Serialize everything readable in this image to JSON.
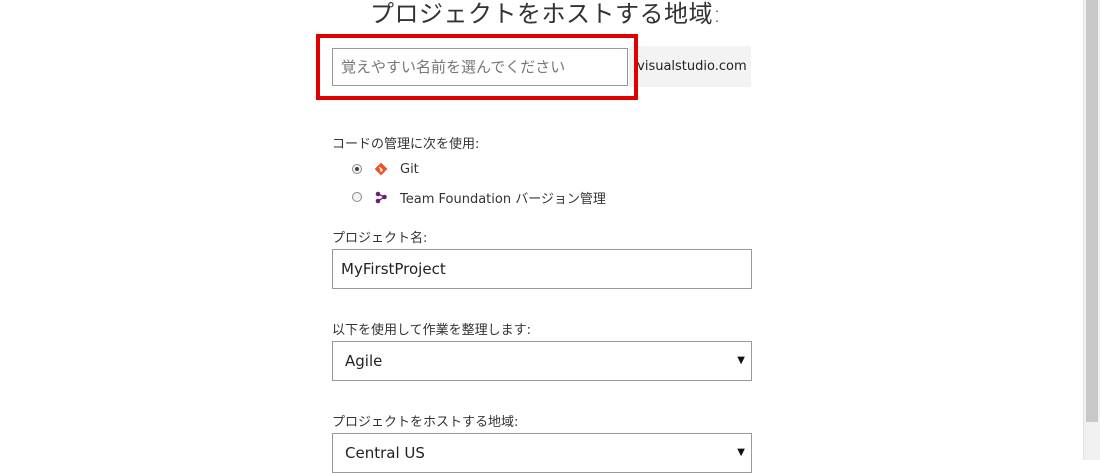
{
  "header": {
    "title": "プロジェクトをホストする地域:"
  },
  "account": {
    "placeholder": "覚えやすい名前を選んでください",
    "domain_suffix": ".visualstudio.com"
  },
  "version_control": {
    "label": "コードの管理に次を使用:",
    "options": [
      {
        "label": "Git",
        "selected": true,
        "icon": "git-icon"
      },
      {
        "label": "Team Foundation バージョン管理",
        "selected": false,
        "icon": "tfvc-icon"
      }
    ]
  },
  "project_name": {
    "label": "プロジェクト名:",
    "value": "MyFirstProject"
  },
  "process": {
    "label": "以下を使用して作業を整理します:",
    "value": "Agile"
  },
  "region": {
    "label": "プロジェクトをホストする地域:",
    "value": "Central US"
  },
  "colors": {
    "highlight": "#e00000",
    "git": "#e8532a",
    "tfvc": "#68217a"
  }
}
